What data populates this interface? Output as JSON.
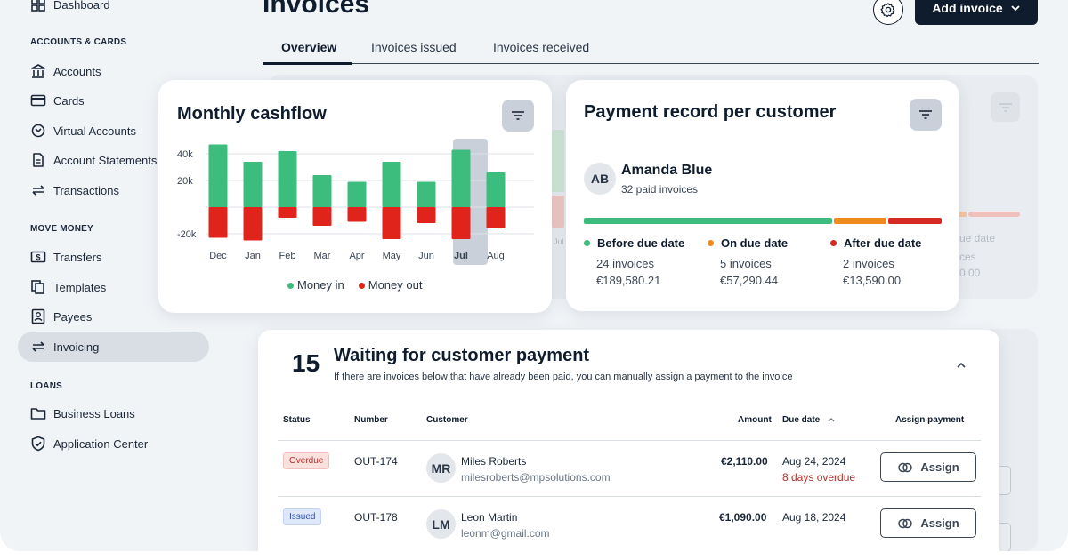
{
  "sidebar": {
    "top_item": "Dashboard",
    "sections": [
      {
        "label": "ACCOUNTS & CARDS",
        "items": [
          "Accounts",
          "Cards",
          "Virtual Accounts",
          "Account Statements",
          "Transactions"
        ]
      },
      {
        "label": "MOVE MONEY",
        "items": [
          "Transfers",
          "Templates",
          "Payees",
          "Invoicing"
        ]
      },
      {
        "label": "LOANS",
        "items": [
          "Business Loans",
          "Application Center"
        ]
      }
    ],
    "active_item": "Invoicing"
  },
  "header": {
    "title": "Invoices",
    "add_button": "Add invoice",
    "tabs": [
      "Overview",
      "Invoices issued",
      "Invoices received"
    ],
    "active_tab": "Overview"
  },
  "cashflow": {
    "title": "Monthly cashflow",
    "legend_in": "Money in",
    "legend_out": "Money out"
  },
  "chart_data": {
    "type": "bar",
    "title": "Monthly cashflow",
    "categories": [
      "Dec",
      "Jan",
      "Feb",
      "Mar",
      "Apr",
      "May",
      "Jun",
      "Jul",
      "Aug"
    ],
    "highlighted": "Jul",
    "y_ticks": [
      "40k",
      "20k",
      "-20k"
    ],
    "ylim": [
      -25000,
      50000
    ],
    "series": [
      {
        "name": "Money in",
        "color": "#3dbd7d",
        "values": [
          47000,
          34000,
          42000,
          24000,
          19000,
          34000,
          19000,
          43000,
          26000
        ]
      },
      {
        "name": "Money out",
        "color": "#e0231b",
        "values": [
          -23000,
          -25000,
          -8000,
          -14000,
          -11000,
          -24000,
          -12000,
          -24000,
          -16000
        ]
      }
    ]
  },
  "payment_record": {
    "title": "Payment record per customer",
    "customer_initials": "AB",
    "customer_name": "Amanda Blue",
    "customer_sub": "32 paid invoices",
    "progress": [
      {
        "fraction": 0.7,
        "color": "#3dbd7d"
      },
      {
        "fraction": 0.15,
        "color": "#f08a1c"
      },
      {
        "fraction": 0.15,
        "color": "#d42a22"
      }
    ],
    "columns": [
      {
        "label": "Before due date",
        "color": "#3dbd7d",
        "count": "24 invoices",
        "amount": "€189,580.21"
      },
      {
        "label": "On due date",
        "color": "#f08a1c",
        "count": "5 invoices",
        "amount": "€57,290.44"
      },
      {
        "label": "After due date",
        "color": "#d42a22",
        "count": "2 invoices",
        "amount": "€13,590.00"
      }
    ]
  },
  "background_card": {
    "axis_label": "Jul",
    "due_label": "ue date",
    "count_label": "ces",
    "amount_label": "0.00"
  },
  "waiting": {
    "count": "15",
    "title": "Waiting for customer payment",
    "subtitle": "If there are invoices below that have already been paid, you can manually assign a payment to the invoice",
    "columns": {
      "status": "Status",
      "number": "Number",
      "customer": "Customer",
      "amount": "Amount",
      "due_date": "Due date",
      "assign": "Assign payment"
    },
    "rows": [
      {
        "status": "Overdue",
        "status_type": "overdue",
        "number": "OUT-174",
        "initials": "MR",
        "name": "Miles Roberts",
        "email": "milesroberts@mpsolutions.com",
        "amount": "€2,110.00",
        "due": "Aug 24, 2024",
        "due_note": "8 days overdue",
        "action": "Assign"
      },
      {
        "status": "Issued",
        "status_type": "issued",
        "number": "OUT-178",
        "initials": "LM",
        "name": "Leon Martin",
        "email": "leonm@gmail.com",
        "amount": "€1,090.00",
        "due": "Aug 18, 2024",
        "due_note": "",
        "action": "Assign"
      }
    ]
  }
}
